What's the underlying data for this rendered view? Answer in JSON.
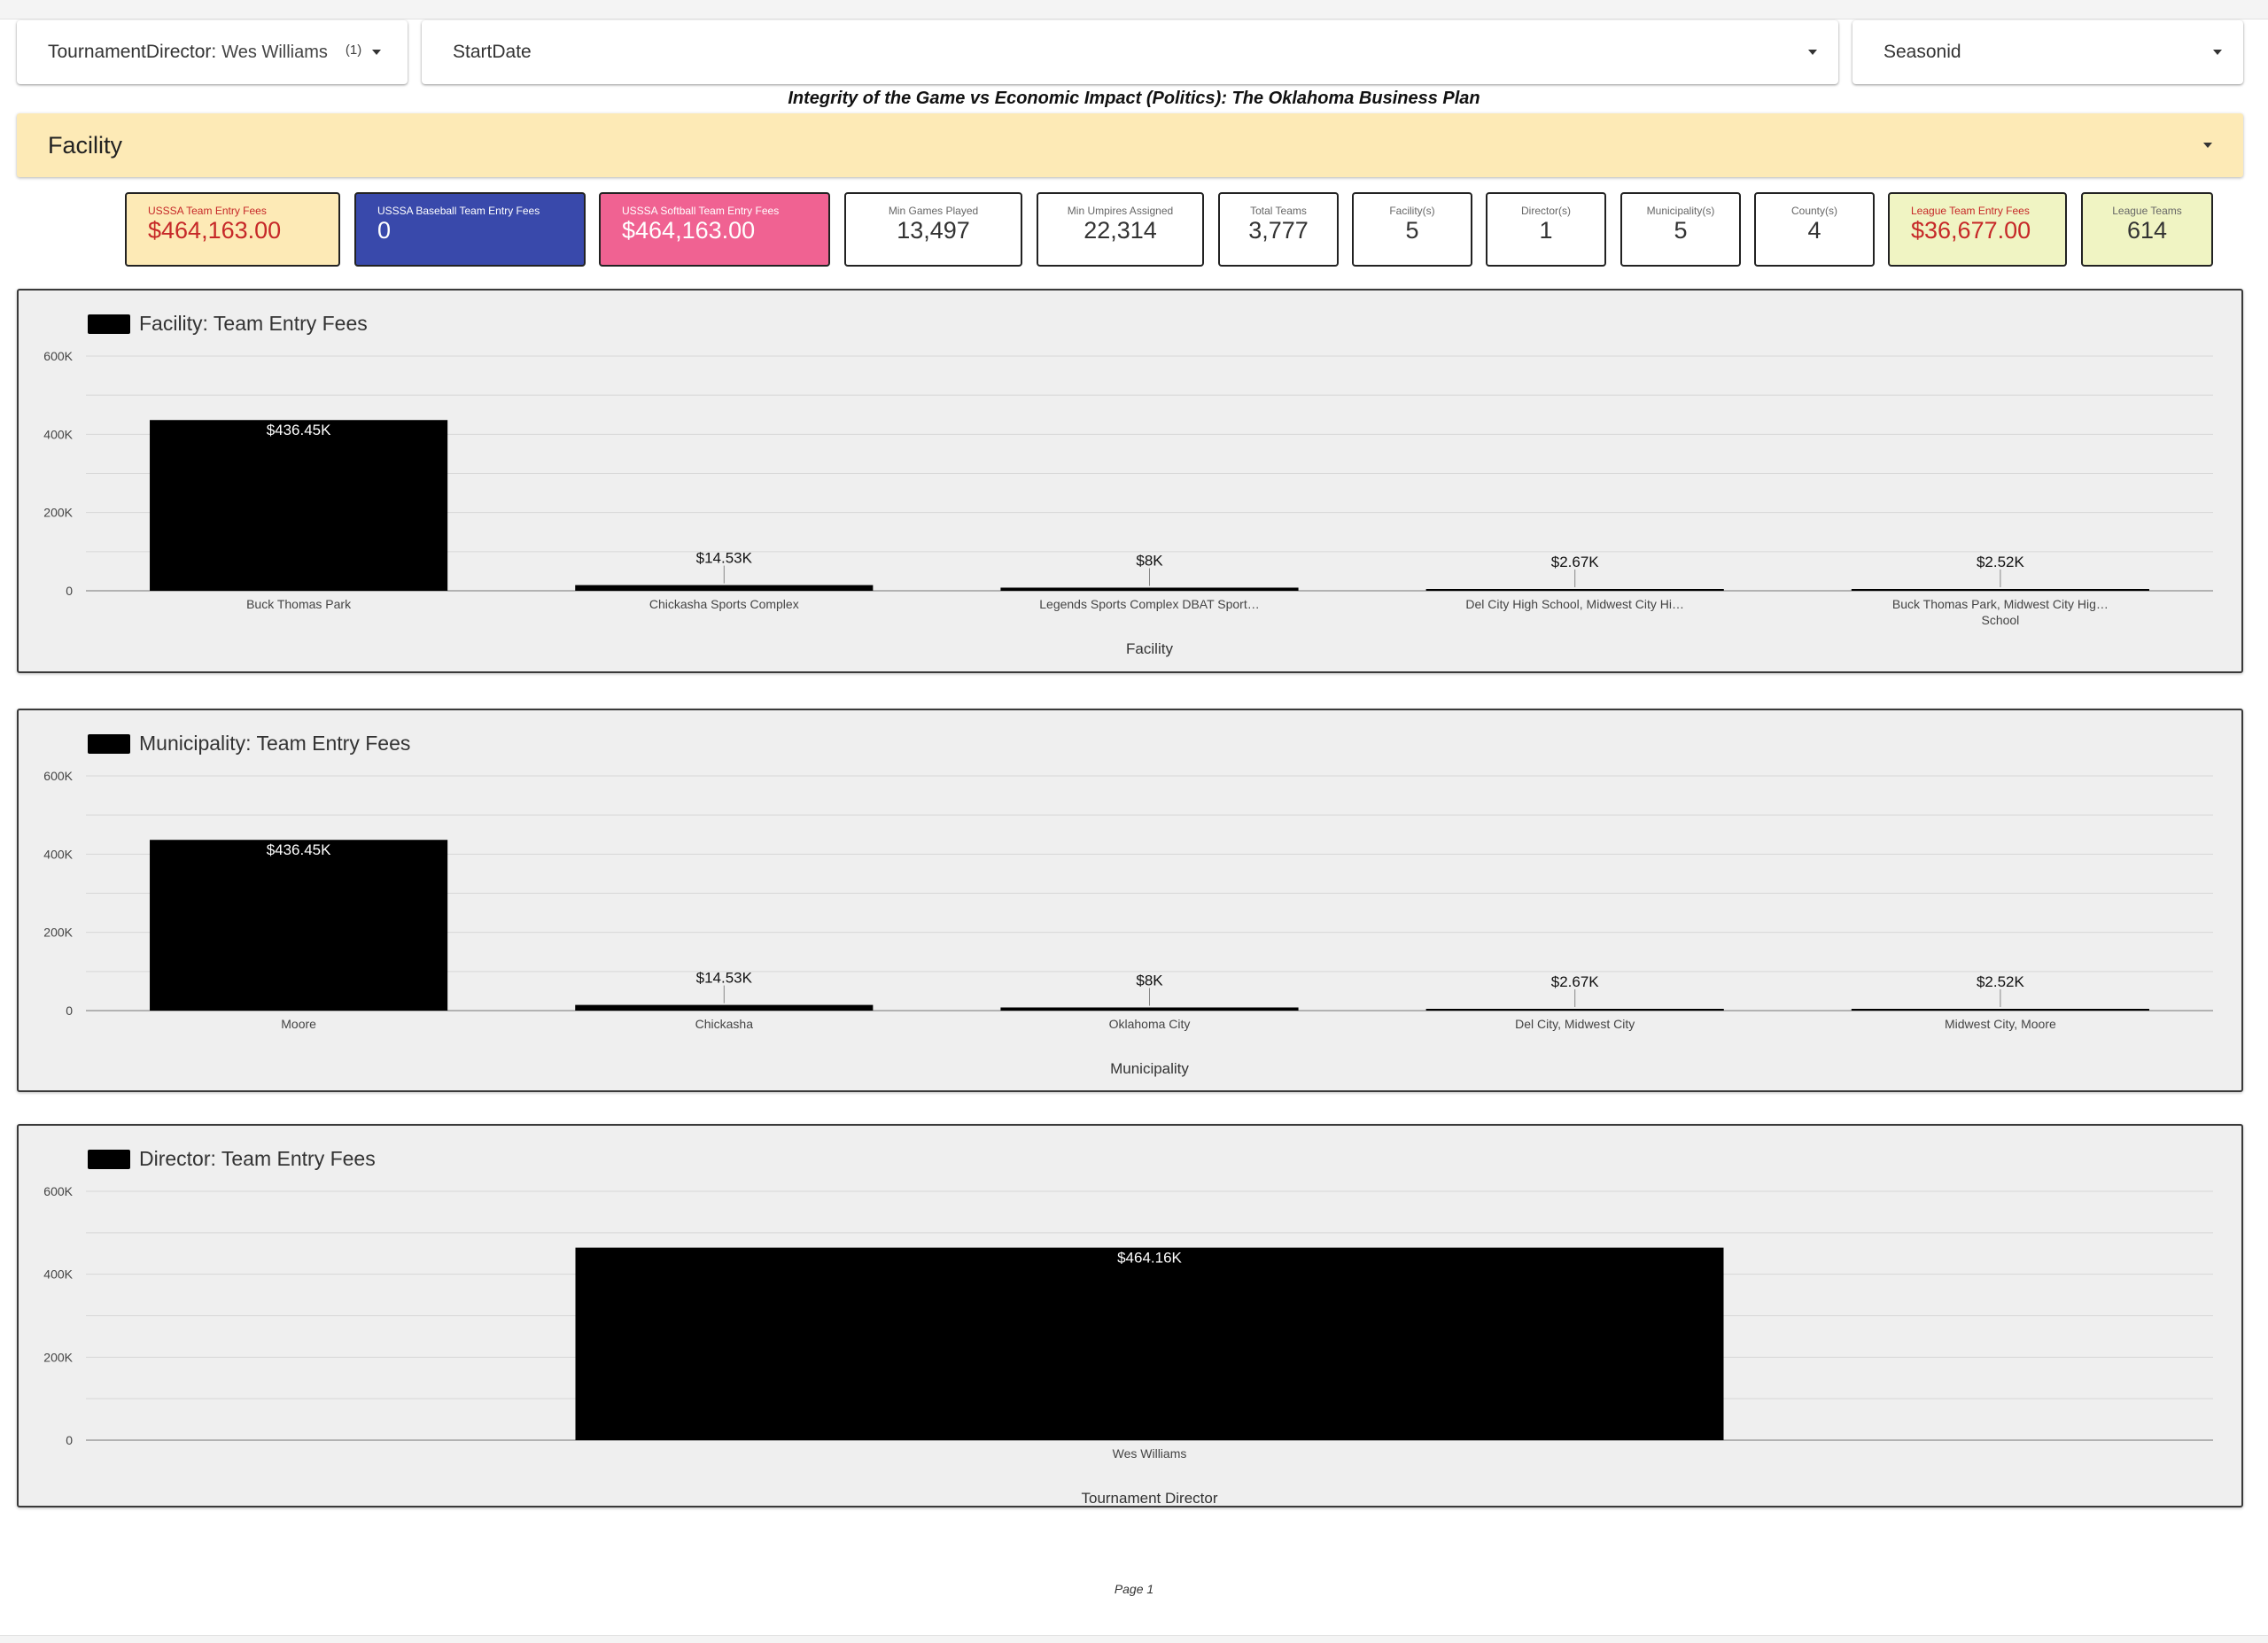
{
  "filters": {
    "director": {
      "label": "TournamentDirector:",
      "value": "Wes Williams",
      "count": "(1)"
    },
    "startdate": {
      "label": "StartDate"
    },
    "season": {
      "label": "Seasonid"
    }
  },
  "report_title": "Integrity of the Game vs Economic Impact (Politics): The Oklahoma Business Plan",
  "section": {
    "label": "Facility"
  },
  "kpis": [
    {
      "title": "USSSA Team Entry Fees",
      "value": "$464,163.00",
      "bg": "#fdeab6",
      "fg": "#c62828",
      "tfg": "#c62828"
    },
    {
      "title": "USSSA Baseball Team Entry Fees",
      "value": "0",
      "bg": "#3949ab",
      "fg": "#ffffff",
      "tfg": "#ffffff"
    },
    {
      "title": "USSSA Softball Team Entry Fees",
      "value": "$464,163.00",
      "bg": "#f06292",
      "fg": "#ffffff",
      "tfg": "#ffffff"
    },
    {
      "title": "Min Games Played",
      "value": "13,497",
      "bg": "#ffffff",
      "fg": "#333333",
      "tfg": "#666666"
    },
    {
      "title": "Min Umpires Assigned",
      "value": "22,314",
      "bg": "#ffffff",
      "fg": "#333333",
      "tfg": "#666666"
    },
    {
      "title": "Total Teams",
      "value": "3,777",
      "bg": "#ffffff",
      "fg": "#333333",
      "tfg": "#666666"
    },
    {
      "title": "Facility(s)",
      "value": "5",
      "bg": "#ffffff",
      "fg": "#333333",
      "tfg": "#666666"
    },
    {
      "title": "Director(s)",
      "value": "1",
      "bg": "#ffffff",
      "fg": "#333333",
      "tfg": "#666666"
    },
    {
      "title": "Municipality(s)",
      "value": "5",
      "bg": "#ffffff",
      "fg": "#333333",
      "tfg": "#666666"
    },
    {
      "title": "County(s)",
      "value": "4",
      "bg": "#ffffff",
      "fg": "#333333",
      "tfg": "#666666"
    },
    {
      "title": "League Team Entry Fees",
      "value": "$36,677.00",
      "bg": "#f0f4c3",
      "fg": "#c62828",
      "tfg": "#c62828"
    },
    {
      "title": "League Teams",
      "value": "614",
      "bg": "#f0f4c3",
      "fg": "#333333",
      "tfg": "#666666"
    }
  ],
  "chart_data": [
    {
      "type": "bar",
      "title": "Facility: Team Entry Fees",
      "xlabel": "Facility",
      "ylabel": "",
      "ylim": [
        0,
        600000
      ],
      "yticks": [
        "0",
        "200K",
        "400K",
        "600K"
      ],
      "categories": [
        "Buck Thomas Park",
        "Chickasha Sports Complex",
        "Legends Sports Complex DBAT Sport…",
        "Del City High School, Midwest City Hi…",
        "Buck Thomas Park, Midwest City Hig… School"
      ],
      "category_lines": [
        [
          "Buck Thomas Park"
        ],
        [
          "Chickasha Sports Complex"
        ],
        [
          "Legends Sports Complex DBAT Sport…"
        ],
        [
          "Del City High School, Midwest City Hi…"
        ],
        [
          "Buck Thomas Park, Midwest City Hig…",
          "School"
        ]
      ],
      "values": [
        436450,
        14530,
        8000,
        2670,
        2520
      ],
      "labels": [
        "$436.45K",
        "$14.53K",
        "$8K",
        "$2.67K",
        "$2.52K"
      ],
      "color": "#000000"
    },
    {
      "type": "bar",
      "title": "Municipality: Team Entry Fees",
      "xlabel": "Municipality",
      "ylabel": "",
      "ylim": [
        0,
        600000
      ],
      "yticks": [
        "0",
        "200K",
        "400K",
        "600K"
      ],
      "categories": [
        "Moore",
        "Chickasha",
        "Oklahoma City",
        "Del City, Midwest City",
        "Midwest City, Moore"
      ],
      "category_lines": [
        [
          "Moore"
        ],
        [
          "Chickasha"
        ],
        [
          "Oklahoma City"
        ],
        [
          "Del City, Midwest City"
        ],
        [
          "Midwest City, Moore"
        ]
      ],
      "values": [
        436450,
        14530,
        8000,
        2670,
        2520
      ],
      "labels": [
        "$436.45K",
        "$14.53K",
        "$8K",
        "$2.67K",
        "$2.52K"
      ],
      "color": "#000000"
    },
    {
      "type": "bar",
      "title": "Director: Team Entry Fees",
      "xlabel": "Tournament Director",
      "ylabel": "",
      "ylim": [
        0,
        600000
      ],
      "yticks": [
        "0",
        "200K",
        "400K",
        "600K"
      ],
      "categories": [
        "Wes Williams"
      ],
      "category_lines": [
        [
          "Wes Williams"
        ]
      ],
      "values": [
        464160
      ],
      "labels": [
        "$464.16K"
      ],
      "color": "#000000"
    }
  ],
  "footer": {
    "page": "Page 1"
  }
}
